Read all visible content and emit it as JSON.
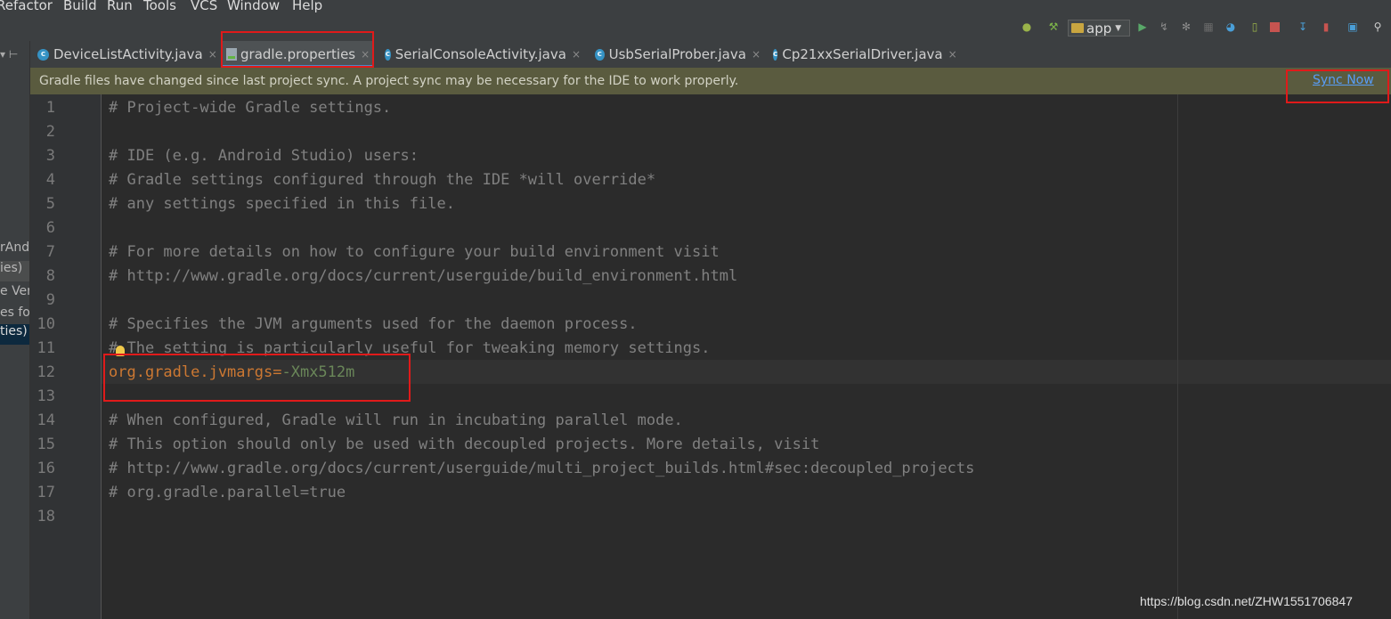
{
  "menu": {
    "items": [
      "Refactor",
      "Build",
      "Run",
      "Tools",
      "VCS",
      "Window",
      "Help"
    ]
  },
  "toolbar": {
    "run_config": "app",
    "icons": [
      "android-icon",
      "hammer-icon",
      "run-icon",
      "apply-changes-icon",
      "debug-icon",
      "attach-icon",
      "profiler-icon",
      "device-icon",
      "stop-icon",
      "sdk-manager-icon",
      "avd-manager-icon",
      "project-structure-icon",
      "search-icon"
    ]
  },
  "left_panel": {
    "fragments": [
      "rAnd",
      "ies)",
      "e Ver",
      "es fo",
      "ties)"
    ]
  },
  "tabs": [
    {
      "label": "DeviceListActivity.java",
      "kind": "class"
    },
    {
      "label": "gradle.properties",
      "kind": "gradle",
      "active": true
    },
    {
      "label": "SerialConsoleActivity.java",
      "kind": "class"
    },
    {
      "label": "UsbSerialProber.java",
      "kind": "class"
    },
    {
      "label": "Cp21xxSerialDriver.java",
      "kind": "class"
    }
  ],
  "notification": {
    "message": "Gradle files have changed since last project sync. A project sync may be necessary for the IDE to work properly.",
    "action": "Sync Now"
  },
  "editor": {
    "line_numbers": [
      "1",
      "2",
      "3",
      "4",
      "5",
      "6",
      "7",
      "8",
      "9",
      "10",
      "11",
      "12",
      "13",
      "14",
      "15",
      "16",
      "17",
      "18"
    ],
    "lines": [
      "# Project-wide Gradle settings.",
      "",
      "# IDE (e.g. Android Studio) users:",
      "# Gradle settings configured through the IDE *will override*",
      "# any settings specified in this file.",
      "",
      "# For more details on how to configure your build environment visit",
      "# http://www.gradle.org/docs/current/userguide/build_environment.html",
      "",
      "# Specifies the JVM arguments used for the daemon process.",
      "# The setting is particularly useful for tweaking memory settings.",
      "",
      "",
      "# When configured, Gradle will run in incubating parallel mode.",
      "# This option should only be used with decoupled projects. More details, visit",
      "# http://www.gradle.org/docs/current/userguide/multi_project_builds.html#sec:decoupled_projects",
      "# org.gradle.parallel=true",
      ""
    ],
    "property_line": {
      "key": "org.gradle.jvmargs",
      "eq": "=",
      "value": "-Xmx512m"
    }
  },
  "watermark": "https://blog.csdn.net/ZHW1551706847",
  "colors": {
    "editor_bg": "#2b2b2b",
    "comment": "#808080",
    "key": "#cc7832",
    "value": "#6a8759",
    "notification_bg": "#5a5b3f",
    "link": "#589df6",
    "annotation": "#e01a1a"
  }
}
